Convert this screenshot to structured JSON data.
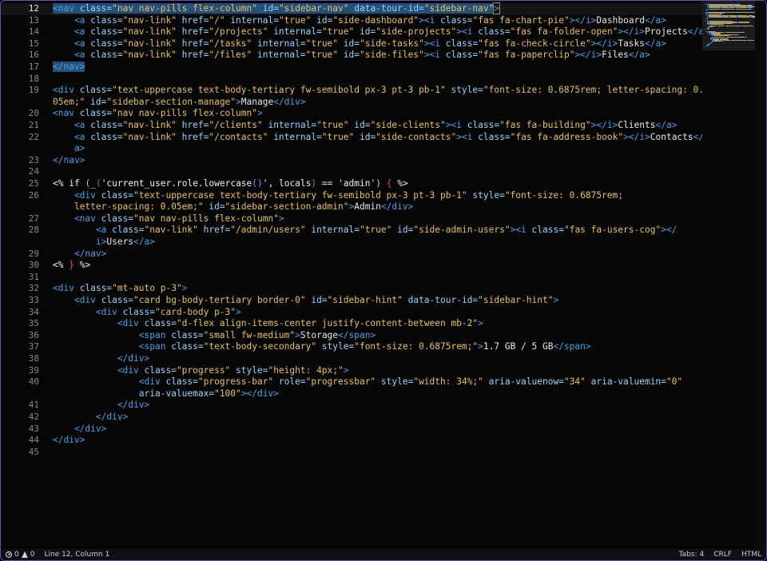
{
  "editor": {
    "lines": [
      {
        "n": "12",
        "segs": [
          [
            "<",
            "tag",
            "hl"
          ],
          [
            "nav ",
            "tag",
            "hl"
          ],
          [
            "class=",
            "attr",
            "hl"
          ],
          [
            "\"nav nav-pills flex-column\" ",
            "str",
            "hl"
          ],
          [
            "id=",
            "attr",
            "hl"
          ],
          [
            "\"sidebar-nav\" ",
            "str",
            "hl"
          ],
          [
            "data-tour-id=",
            "attr",
            "hl"
          ],
          [
            "\"sidebar-nav\"",
            "str",
            "hl"
          ],
          [
            ">",
            "tag",
            "box"
          ]
        ]
      },
      {
        "n": "13",
        "segs": [
          [
            "    <a ",
            "tag"
          ],
          [
            "class=",
            "attr"
          ],
          [
            "\"nav-link\" ",
            "str"
          ],
          [
            "href=",
            "attr"
          ],
          [
            "\"/\" ",
            "str"
          ],
          [
            "internal=",
            "attr"
          ],
          [
            "\"true\" ",
            "str"
          ],
          [
            "id=",
            "attr"
          ],
          [
            "\"side-dashboard\"",
            "str"
          ],
          [
            "><i ",
            "tag"
          ],
          [
            "class=",
            "attr"
          ],
          [
            "\"fas fa-chart-pie\"",
            "str"
          ],
          [
            "></i>",
            "tag"
          ],
          [
            "Dashboard",
            "txt"
          ],
          [
            "</a>",
            "tag"
          ]
        ]
      },
      {
        "n": "14",
        "segs": [
          [
            "    <a ",
            "tag"
          ],
          [
            "class=",
            "attr"
          ],
          [
            "\"nav-link\" ",
            "str"
          ],
          [
            "href=",
            "attr"
          ],
          [
            "\"/projects\" ",
            "str"
          ],
          [
            "internal=",
            "attr"
          ],
          [
            "\"true\" ",
            "str"
          ],
          [
            "id=",
            "attr"
          ],
          [
            "\"side-projects\"",
            "str"
          ],
          [
            "><i ",
            "tag"
          ],
          [
            "class=",
            "attr"
          ],
          [
            "\"fas fa-folder-open\"",
            "str"
          ],
          [
            "></i>",
            "tag"
          ],
          [
            "Projects",
            "txt"
          ],
          [
            "</a>",
            "tag"
          ]
        ]
      },
      {
        "n": "15",
        "segs": [
          [
            "    <a ",
            "tag"
          ],
          [
            "class=",
            "attr"
          ],
          [
            "\"nav-link\" ",
            "str"
          ],
          [
            "href=",
            "attr"
          ],
          [
            "\"/tasks\" ",
            "str"
          ],
          [
            "internal=",
            "attr"
          ],
          [
            "\"true\" ",
            "str"
          ],
          [
            "id=",
            "attr"
          ],
          [
            "\"side-tasks\"",
            "str"
          ],
          [
            "><i ",
            "tag"
          ],
          [
            "class=",
            "attr"
          ],
          [
            "\"fas fa-check-circle\"",
            "str"
          ],
          [
            "></i>",
            "tag"
          ],
          [
            "Tasks",
            "txt"
          ],
          [
            "</a>",
            "tag"
          ]
        ]
      },
      {
        "n": "16",
        "segs": [
          [
            "    <a ",
            "tag"
          ],
          [
            "class=",
            "attr"
          ],
          [
            "\"nav-link\" ",
            "str"
          ],
          [
            "href=",
            "attr"
          ],
          [
            "\"/files\" ",
            "str"
          ],
          [
            "internal=",
            "attr"
          ],
          [
            "\"true\" ",
            "str"
          ],
          [
            "id=",
            "attr"
          ],
          [
            "\"side-files\"",
            "str"
          ],
          [
            "><i ",
            "tag"
          ],
          [
            "class=",
            "attr"
          ],
          [
            "\"fas fa-paperclip\"",
            "str"
          ],
          [
            "></i>",
            "tag"
          ],
          [
            "Files",
            "txt"
          ],
          [
            "</a>",
            "tag"
          ]
        ]
      },
      {
        "n": "17",
        "segs": [
          [
            "</nav>",
            "tag",
            "hl"
          ]
        ]
      },
      {
        "n": "18",
        "segs": []
      },
      {
        "n": "19",
        "segs": [
          [
            "<div ",
            "tag"
          ],
          [
            "class=",
            "attr"
          ],
          [
            "\"text-uppercase text-body-tertiary fw-semibold px-3 pt-3 pb-1\" ",
            "str"
          ],
          [
            "style=",
            "attr"
          ],
          [
            "\"font-size: 0.6875rem; letter-spacing: 0.",
            "str"
          ]
        ]
      },
      {
        "n": "",
        "segs": [
          [
            "05em;\" ",
            "str"
          ],
          [
            "id=",
            "attr"
          ],
          [
            "\"sidebar-section-manage\"",
            "str"
          ],
          [
            ">",
            "tag"
          ],
          [
            "Manage",
            "txt"
          ],
          [
            "</div>",
            "tag"
          ]
        ]
      },
      {
        "n": "20",
        "segs": [
          [
            "<nav ",
            "tag"
          ],
          [
            "class=",
            "attr"
          ],
          [
            "\"nav nav-pills flex-column\"",
            "str"
          ],
          [
            ">",
            "tag"
          ]
        ]
      },
      {
        "n": "21",
        "segs": [
          [
            "    <a ",
            "tag"
          ],
          [
            "class=",
            "attr"
          ],
          [
            "\"nav-link\" ",
            "str"
          ],
          [
            "href=",
            "attr"
          ],
          [
            "\"/clients\" ",
            "str"
          ],
          [
            "internal=",
            "attr"
          ],
          [
            "\"true\" ",
            "str"
          ],
          [
            "id=",
            "attr"
          ],
          [
            "\"side-clients\"",
            "str"
          ],
          [
            "><i ",
            "tag"
          ],
          [
            "class=",
            "attr"
          ],
          [
            "\"fas fa-building\"",
            "str"
          ],
          [
            "></i>",
            "tag"
          ],
          [
            "Clients",
            "txt"
          ],
          [
            "</a>",
            "tag"
          ]
        ]
      },
      {
        "n": "22",
        "segs": [
          [
            "    <a ",
            "tag"
          ],
          [
            "class=",
            "attr"
          ],
          [
            "\"nav-link\" ",
            "str"
          ],
          [
            "href=",
            "attr"
          ],
          [
            "\"/contacts\" ",
            "str"
          ],
          [
            "internal=",
            "attr"
          ],
          [
            "\"true\" ",
            "str"
          ],
          [
            "id=",
            "attr"
          ],
          [
            "\"side-contacts\"",
            "str"
          ],
          [
            "><i ",
            "tag"
          ],
          [
            "class=",
            "attr"
          ],
          [
            "\"fas fa-address-book\"",
            "str"
          ],
          [
            "></i>",
            "tag"
          ],
          [
            "Contacts",
            "txt"
          ],
          [
            "</",
            "tag"
          ]
        ]
      },
      {
        "n": "",
        "segs": [
          [
            "    a>",
            "tag"
          ]
        ]
      },
      {
        "n": "23",
        "segs": [
          [
            "</nav>",
            "tag"
          ]
        ]
      },
      {
        "n": "24",
        "segs": []
      },
      {
        "n": "25",
        "segs": [
          [
            "<% ",
            "kw"
          ],
          [
            "if ",
            "kw"
          ],
          [
            "(",
            "br2"
          ],
          [
            "_",
            "kw"
          ],
          [
            "(",
            "br"
          ],
          [
            "'current_user.role.lowercase",
            "kw"
          ],
          [
            "()",
            "br3"
          ],
          [
            "', locals",
            "kw"
          ],
          [
            ")",
            "br"
          ],
          [
            " == 'admin'",
            "kw"
          ],
          [
            ")",
            "br2"
          ],
          [
            " ",
            "kw"
          ],
          [
            "{",
            "red"
          ],
          [
            " %>",
            "kw"
          ]
        ]
      },
      {
        "n": "26",
        "segs": [
          [
            "    <div ",
            "tag"
          ],
          [
            "class=",
            "attr"
          ],
          [
            "\"text-uppercase text-body-tertiary fw-semibold px-3 pt-3 pb-1\" ",
            "str"
          ],
          [
            "style=",
            "attr"
          ],
          [
            "\"font-size: 0.6875rem;",
            "str"
          ]
        ]
      },
      {
        "n": "",
        "segs": [
          [
            "    letter-spacing: 0.05em;\" ",
            "str"
          ],
          [
            "id=",
            "attr"
          ],
          [
            "\"sidebar-section-admin\"",
            "str"
          ],
          [
            ">",
            "tag"
          ],
          [
            "Admin",
            "txt"
          ],
          [
            "</div>",
            "tag"
          ]
        ]
      },
      {
        "n": "27",
        "segs": [
          [
            "    <nav ",
            "tag"
          ],
          [
            "class=",
            "attr"
          ],
          [
            "\"nav nav-pills flex-column\"",
            "str"
          ],
          [
            ">",
            "tag"
          ]
        ]
      },
      {
        "n": "28",
        "segs": [
          [
            "        <a ",
            "tag"
          ],
          [
            "class=",
            "attr"
          ],
          [
            "\"nav-link\" ",
            "str"
          ],
          [
            "href=",
            "attr"
          ],
          [
            "\"/admin/users\" ",
            "str"
          ],
          [
            "internal=",
            "attr"
          ],
          [
            "\"true\" ",
            "str"
          ],
          [
            "id=",
            "attr"
          ],
          [
            "\"side-admin-users\"",
            "str"
          ],
          [
            "><i ",
            "tag"
          ],
          [
            "class=",
            "attr"
          ],
          [
            "\"fas fa-users-cog\"",
            "str"
          ],
          [
            "></",
            "tag"
          ]
        ]
      },
      {
        "n": "",
        "segs": [
          [
            "        i>",
            "tag"
          ],
          [
            "Users",
            "txt"
          ],
          [
            "</a>",
            "tag"
          ]
        ]
      },
      {
        "n": "29",
        "segs": [
          [
            "    </nav>",
            "tag"
          ]
        ]
      },
      {
        "n": "30",
        "segs": [
          [
            "<% ",
            "kw"
          ],
          [
            "}",
            "red"
          ],
          [
            " %>",
            "kw"
          ]
        ]
      },
      {
        "n": "31",
        "segs": []
      },
      {
        "n": "32",
        "segs": [
          [
            "<div ",
            "tag"
          ],
          [
            "class=",
            "attr"
          ],
          [
            "\"mt-auto p-3\"",
            "str"
          ],
          [
            ">",
            "tag"
          ]
        ]
      },
      {
        "n": "33",
        "segs": [
          [
            "    <div ",
            "tag"
          ],
          [
            "class=",
            "attr"
          ],
          [
            "\"card bg-body-tertiary border-0\" ",
            "str"
          ],
          [
            "id=",
            "attr"
          ],
          [
            "\"sidebar-hint\" ",
            "str"
          ],
          [
            "data-tour-id=",
            "attr"
          ],
          [
            "\"sidebar-hint\"",
            "str"
          ],
          [
            ">",
            "tag"
          ]
        ]
      },
      {
        "n": "34",
        "segs": [
          [
            "        <div ",
            "tag"
          ],
          [
            "class=",
            "attr"
          ],
          [
            "\"card-body p-3\"",
            "str"
          ],
          [
            ">",
            "tag"
          ]
        ]
      },
      {
        "n": "35",
        "segs": [
          [
            "            <div ",
            "tag"
          ],
          [
            "class=",
            "attr"
          ],
          [
            "\"d-flex align-items-center justify-content-between mb-2\"",
            "str"
          ],
          [
            ">",
            "tag"
          ]
        ]
      },
      {
        "n": "36",
        "segs": [
          [
            "                <span ",
            "tag"
          ],
          [
            "class=",
            "attr"
          ],
          [
            "\"small fw-medium\"",
            "str"
          ],
          [
            ">",
            "tag"
          ],
          [
            "Storage",
            "txt"
          ],
          [
            "</span>",
            "tag"
          ]
        ]
      },
      {
        "n": "37",
        "segs": [
          [
            "                <span ",
            "tag"
          ],
          [
            "class=",
            "attr"
          ],
          [
            "\"text-body-secondary\" ",
            "str"
          ],
          [
            "style=",
            "attr"
          ],
          [
            "\"font-size: 0.6875rem;\"",
            "str"
          ],
          [
            ">",
            "tag"
          ],
          [
            "1.7 GB / 5 GB",
            "txt"
          ],
          [
            "</span>",
            "tag"
          ]
        ]
      },
      {
        "n": "38",
        "segs": [
          [
            "            </div>",
            "tag"
          ]
        ]
      },
      {
        "n": "39",
        "segs": [
          [
            "            <div ",
            "tag"
          ],
          [
            "class=",
            "attr"
          ],
          [
            "\"progress\" ",
            "str"
          ],
          [
            "style=",
            "attr"
          ],
          [
            "\"height: 4px;\"",
            "str"
          ],
          [
            ">",
            "tag"
          ]
        ]
      },
      {
        "n": "40",
        "segs": [
          [
            "                <div ",
            "tag"
          ],
          [
            "class=",
            "attr"
          ],
          [
            "\"progress-bar\" ",
            "str"
          ],
          [
            "role=",
            "attr"
          ],
          [
            "\"progressbar\" ",
            "str"
          ],
          [
            "style=",
            "attr"
          ],
          [
            "\"width: 34%;\" ",
            "str"
          ],
          [
            "aria-valuenow=",
            "attr"
          ],
          [
            "\"34\" ",
            "str"
          ],
          [
            "aria-valuemin=",
            "attr"
          ],
          [
            "\"0\"",
            "str"
          ]
        ]
      },
      {
        "n": "",
        "segs": [
          [
            "                aria-valuemax=",
            "attr"
          ],
          [
            "\"100\"",
            "str"
          ],
          [
            "></div>",
            "tag"
          ]
        ]
      },
      {
        "n": "41",
        "segs": [
          [
            "            </div>",
            "tag"
          ]
        ]
      },
      {
        "n": "42",
        "segs": [
          [
            "        </div>",
            "tag"
          ]
        ]
      },
      {
        "n": "43",
        "segs": [
          [
            "    </div>",
            "tag"
          ]
        ]
      },
      {
        "n": "44",
        "segs": [
          [
            "</div>",
            "tag"
          ]
        ]
      },
      {
        "n": "45",
        "segs": []
      }
    ],
    "current_line": "12"
  },
  "statusbar": {
    "errors": "0",
    "warnings": "0",
    "position": "Line 12, Column 1",
    "tabs": "Tabs: 4",
    "eol": "CRLF",
    "language": "HTML"
  },
  "colors": {
    "tag": "#4fa0e6",
    "attr": "#9bd3ff",
    "string": "#e7c06a",
    "text": "#e6e6e6",
    "border": "#6a4fb0"
  }
}
